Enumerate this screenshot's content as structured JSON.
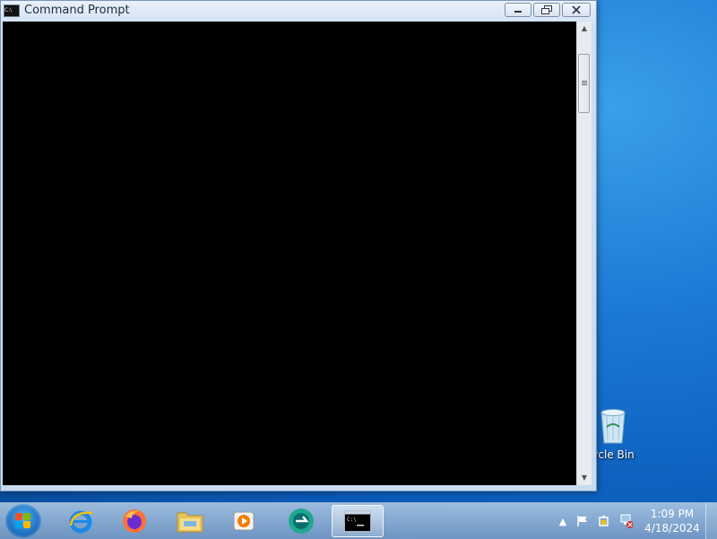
{
  "window": {
    "title": "Command Prompt",
    "icon": "cmd-icon",
    "icon_text": "C:\\",
    "buttons": {
      "minimize": "minimize-icon",
      "maximize": "restore-icon",
      "close": "close-icon"
    }
  },
  "desktop": {
    "icons": [
      {
        "label": "ycle Bin",
        "icon": "recycle-bin-icon"
      }
    ]
  },
  "taskbar": {
    "apps": [
      {
        "name": "internet-explorer",
        "icon": "ie-icon"
      },
      {
        "name": "firefox",
        "icon": "firefox-icon"
      },
      {
        "name": "file-explorer",
        "icon": "folder-icon"
      },
      {
        "name": "media-player",
        "icon": "media-player-icon"
      },
      {
        "name": "app",
        "icon": "teal-app-icon"
      },
      {
        "name": "command-prompt",
        "icon": "cmd-icon",
        "active": true
      }
    ],
    "tray": {
      "icons": [
        "show-hidden-icons-icon",
        "action-center-flag-icon",
        "power-icon",
        "network-icon"
      ],
      "time": "1:09 PM",
      "date": "4/18/2024"
    }
  },
  "colors": {
    "console_bg": "#000000",
    "desktop": "#1a78d4"
  }
}
